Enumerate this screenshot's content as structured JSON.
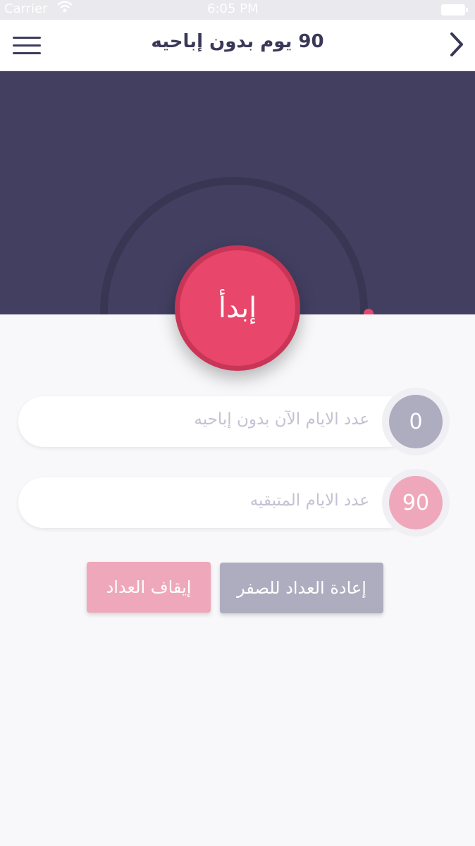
{
  "status_bar": {
    "carrier": "Carrier",
    "time": "6:05 PM"
  },
  "header": {
    "title": "90 يوم بدون إباحيه"
  },
  "hero": {
    "start_label": "إبدأ",
    "accent_color": "#e8466b",
    "background_color": "#433f61"
  },
  "stats": [
    {
      "value": "0",
      "label": "عدد الايام الآن بدون إباحيه",
      "color": "#aeacbf"
    },
    {
      "value": "90",
      "label": "عدد الايام المتبقيه",
      "color": "#efa8bb"
    }
  ],
  "actions": {
    "reset_label": "إعادة العداد للصفر",
    "stop_label": "إيقاف العداد"
  }
}
